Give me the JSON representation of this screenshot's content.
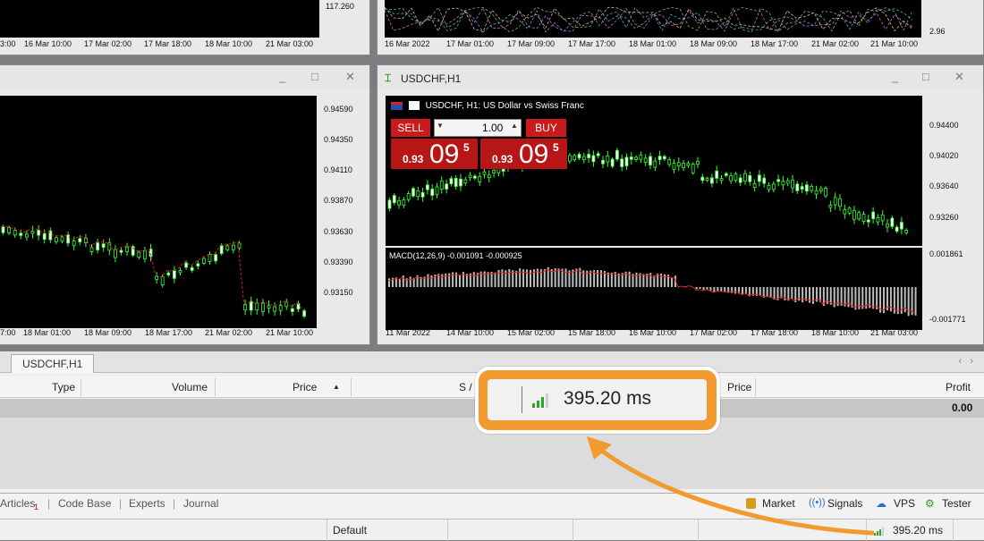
{
  "top_left_chart": {
    "price_label": "117.260",
    "time_labels": [
      "3:00",
      "16 Mar 10:00",
      "17 Mar 02:00",
      "17 Mar 18:00",
      "18 Mar 10:00",
      "21 Mar 03:00"
    ]
  },
  "top_right_chart": {
    "price_label": "2.96",
    "time_labels": [
      "16 Mar 2022",
      "17 Mar 01:00",
      "17 Mar 09:00",
      "17 Mar 17:00",
      "18 Mar 01:00",
      "18 Mar 09:00",
      "18 Mar 17:00",
      "21 Mar 02:00",
      "21 Mar 10:00"
    ]
  },
  "left_chart": {
    "price_labels": [
      "0.94590",
      "0.94350",
      "0.94110",
      "0.93870",
      "0.93630",
      "0.93390",
      "0.93150"
    ],
    "time_labels": [
      "7:00",
      "18 Mar 01:00",
      "18 Mar 09:00",
      "18 Mar 17:00",
      "21 Mar 02:00",
      "21 Mar 10:00"
    ],
    "controls": {
      "minimize": "_",
      "maximize": "□",
      "close": "✕"
    }
  },
  "right_chart": {
    "window_title": "USDCHF,H1",
    "symbol_info": "USDCHF, H1:  US Dollar vs Swiss Franc",
    "sell_label": "SELL",
    "buy_label": "BUY",
    "lot_value": "1.00",
    "sell_price_small": "0.93",
    "sell_price_big": "09",
    "sell_price_sup": "5",
    "buy_price_small": "0.93",
    "buy_price_big": "09",
    "buy_price_sup": "5",
    "price_labels": [
      "0.94400",
      "0.94020",
      "0.93640",
      "0.93260"
    ],
    "macd_label": "MACD(12,26,9) -0.001091 -0.000925",
    "macd_labels": [
      "0.001861",
      "-0.001771"
    ],
    "time_labels": [
      "11 Mar 2022",
      "14 Mar 10:00",
      "15 Mar 02:00",
      "15 Mar 18:00",
      "16 Mar 10:00",
      "17 Mar 02:00",
      "17 Mar 18:00",
      "18 Mar 10:00",
      "21 Mar 03:00"
    ],
    "controls": {
      "minimize": "_",
      "maximize": "□",
      "close": "✕"
    },
    "icon": "chart-icon"
  },
  "toolbox": {
    "tab_label": "USDCHF,H1",
    "columns": {
      "type": "Type",
      "volume": "Volume",
      "price": "Price",
      "sl": "S /",
      "price2": "Price",
      "profit": "Profit"
    },
    "profit_value": "0.00",
    "bottom_tabs": {
      "articles": "Articles",
      "articles_badge": "1",
      "codebase": "Code Base",
      "experts": "Experts",
      "journal": "Journal"
    },
    "right_tabs": {
      "market": "Market",
      "signals": "Signals",
      "vps": "VPS",
      "tester": "Tester"
    }
  },
  "status_bar": {
    "profile": "Default",
    "ping": "395.20 ms"
  },
  "callout": {
    "ping": "395.20 ms",
    "color": "#f29a2e"
  }
}
